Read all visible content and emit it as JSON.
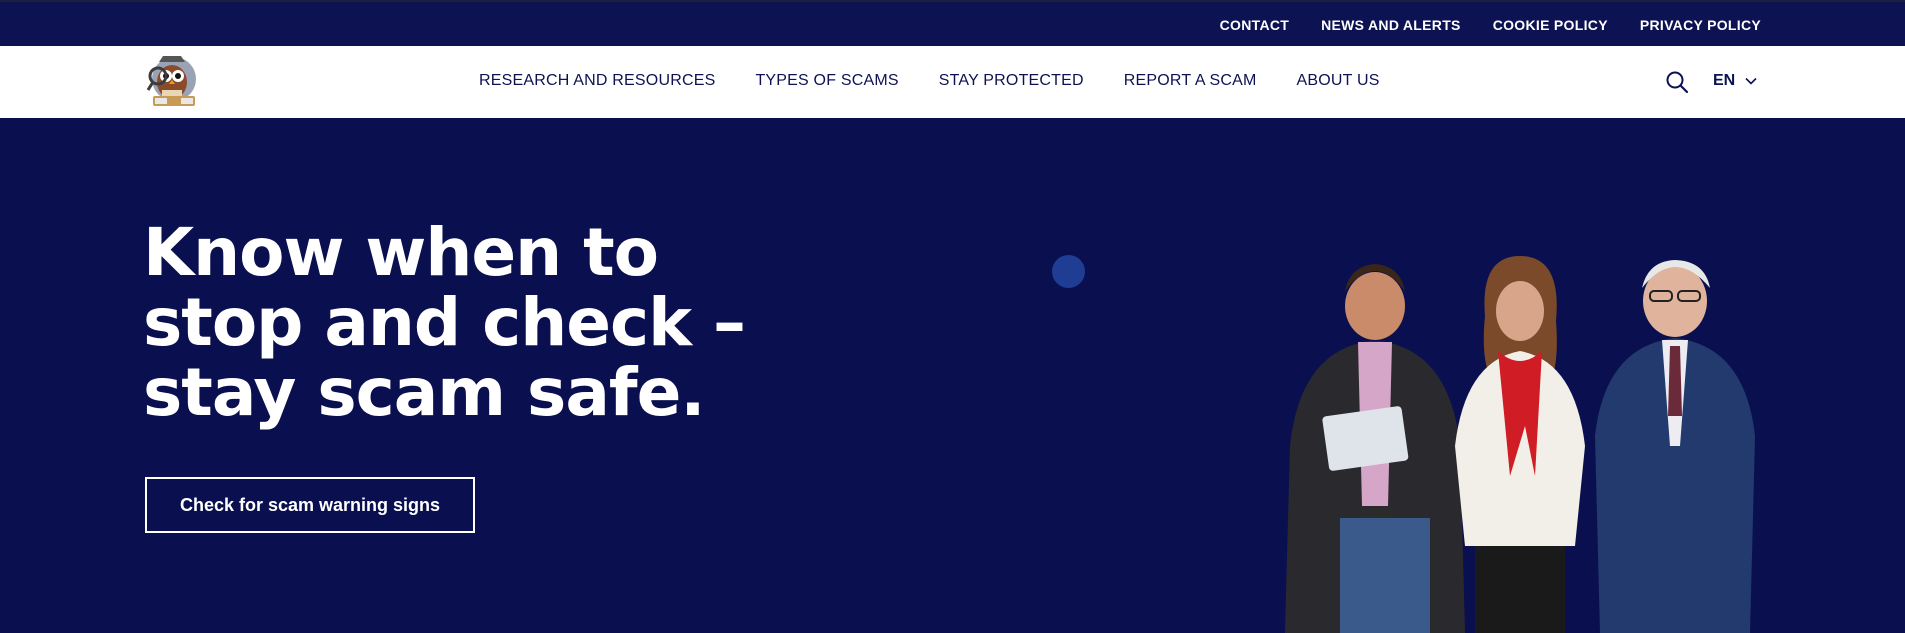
{
  "topbar": {
    "links": [
      "CONTACT",
      "NEWS AND ALERTS",
      "COOKIE POLICY",
      "PRIVACY POLICY"
    ]
  },
  "nav": {
    "logo_icon": "owl-detective-logo",
    "items": [
      "RESEARCH AND RESOURCES",
      "TYPES OF SCAMS",
      "STAY PROTECTED",
      "REPORT A SCAM",
      "ABOUT US"
    ],
    "search_icon": "search-icon",
    "language": "EN"
  },
  "hero": {
    "title": "Know when to stop and check – stay scam safe.",
    "cta_label": "Check for scam warning signs"
  },
  "colors": {
    "navy": "#0a104f",
    "topbar": "#0d1352",
    "accent_dot": "#1f3d93",
    "white": "#ffffff"
  }
}
